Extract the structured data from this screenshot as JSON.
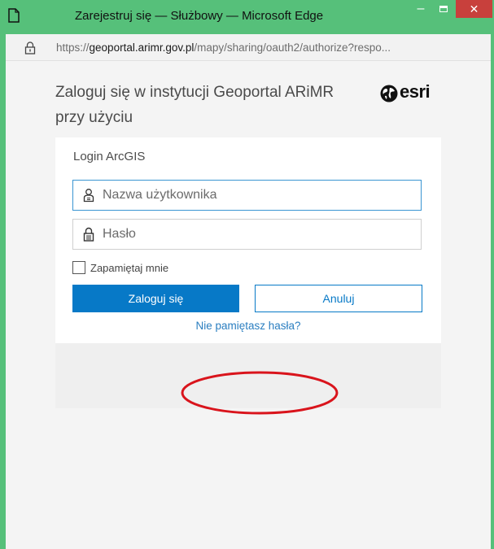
{
  "window": {
    "title": "Zarejestruj się — Służbowy — Microsoft Edge",
    "minimize_label": "–",
    "close_label": "✕"
  },
  "address": {
    "url_prefix": "https://",
    "url_host": "geoportal.arimr.gov.pl",
    "url_path": "/mapy/sharing/oauth2/authorize?respo..."
  },
  "login": {
    "heading": "Zaloguj się w instytucji Geoportal ARiMR przy użyciu",
    "logo_text": "esri",
    "panel_title": "Login ArcGIS",
    "username_placeholder": "Nazwa użytkownika",
    "username_value": "",
    "password_placeholder": "Hasło",
    "password_value": "",
    "remember_label": "Zapamiętaj mnie",
    "remember_checked": false,
    "login_button": "Zaloguj się",
    "cancel_button": "Anuluj",
    "forgot_link": "Nie pamiętasz hasła?"
  },
  "colors": {
    "titlebar": "#56c07a",
    "close_button": "#c8403c",
    "primary": "#0779c7",
    "link": "#2a7ec0",
    "highlight": "#d9141c"
  },
  "icons": [
    "app-page-icon",
    "lock-icon",
    "user-icon",
    "padlock-icon",
    "esri-globe-icon",
    "checkbox"
  ]
}
